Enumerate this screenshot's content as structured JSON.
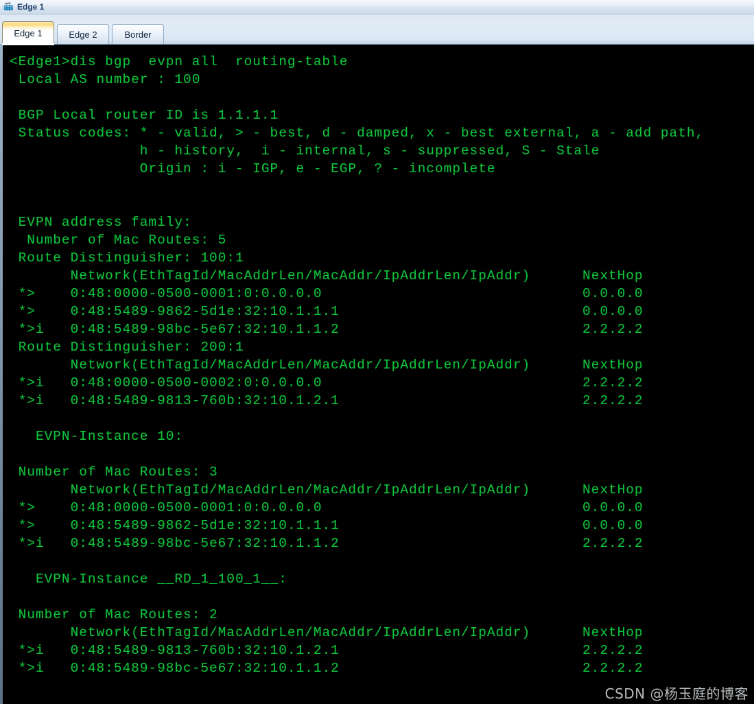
{
  "window": {
    "title": "Edge 1",
    "icon": "router-device-icon"
  },
  "tabs": [
    {
      "label": "Edge 1",
      "active": true
    },
    {
      "label": "Edge 2",
      "active": false
    },
    {
      "label": "Border",
      "active": false
    }
  ],
  "terminal": {
    "prompt": "<Edge1>",
    "command": "dis bgp  evpn all  routing-table",
    "foreground_color": "#0fc43c",
    "background_color": "#000000",
    "lines": [
      "<Edge1>dis bgp  evpn all  routing-table",
      " Local AS number : 100",
      "",
      " BGP Local router ID is 1.1.1.1",
      " Status codes: * - valid, > - best, d - damped, x - best external, a - add path,",
      "               h - history,  i - internal, s - suppressed, S - Stale",
      "               Origin : i - IGP, e - EGP, ? - incomplete",
      "",
      "",
      " EVPN address family:",
      "  Number of Mac Routes: 5",
      " Route Distinguisher: 100:1",
      "       Network(EthTagId/MacAddrLen/MacAddr/IpAddrLen/IpAddr)      NextHop",
      " *>    0:48:0000-0500-0001:0:0.0.0.0                              0.0.0.0",
      " *>    0:48:5489-9862-5d1e:32:10.1.1.1                            0.0.0.0",
      " *>i   0:48:5489-98bc-5e67:32:10.1.1.2                            2.2.2.2",
      " Route Distinguisher: 200:1",
      "       Network(EthTagId/MacAddrLen/MacAddr/IpAddrLen/IpAddr)      NextHop",
      " *>i   0:48:0000-0500-0002:0:0.0.0.0                              2.2.2.2",
      " *>i   0:48:5489-9813-760b:32:10.1.2.1                            2.2.2.2",
      "",
      "   EVPN-Instance 10:",
      "",
      " Number of Mac Routes: 3",
      "       Network(EthTagId/MacAddrLen/MacAddr/IpAddrLen/IpAddr)      NextHop",
      " *>    0:48:0000-0500-0001:0:0.0.0.0                              0.0.0.0",
      " *>    0:48:5489-9862-5d1e:32:10.1.1.1                            0.0.0.0",
      " *>i   0:48:5489-98bc-5e67:32:10.1.1.2                            2.2.2.2",
      "",
      "   EVPN-Instance __RD_1_100_1__:",
      "",
      " Number of Mac Routes: 2",
      "       Network(EthTagId/MacAddrLen/MacAddr/IpAddrLen/IpAddr)      NextHop",
      " *>i   0:48:5489-9813-760b:32:10.1.2.1                            2.2.2.2",
      " *>i   0:48:5489-98bc-5e67:32:10.1.1.2                            2.2.2.2"
    ]
  },
  "watermark": {
    "text": "CSDN @杨玉庭的博客"
  }
}
